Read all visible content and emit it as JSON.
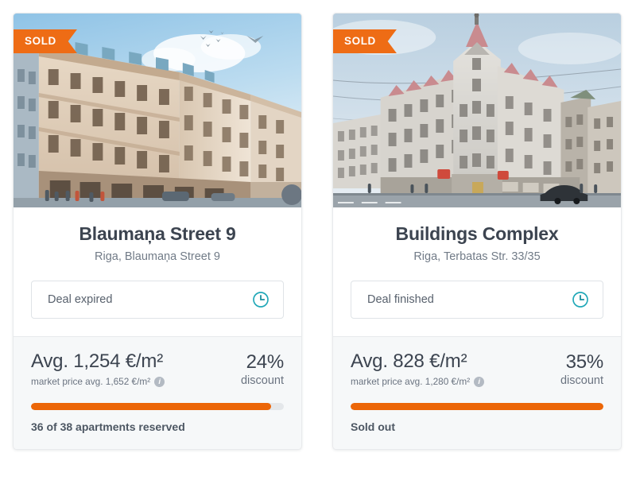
{
  "theme": {
    "accent_orange": "#ec6608",
    "badge_orange": "#ee6c15",
    "clock_teal": "#21a8b8",
    "text_dark": "#3c4450",
    "text_muted": "#6a7380",
    "footer_bg": "#f6f8f9"
  },
  "cards": [
    {
      "badge": "SOLD",
      "badge_icon": "ribbon-badge",
      "image_alt": "blaumana-street-9-building-render",
      "title": "Blaumaņa Street 9",
      "subtitle": "Riga, Blaumaņa Street 9",
      "deal_status": "Deal expired",
      "deal_status_icon": "clock-icon",
      "avg_price": "Avg. 1,254 €/m²",
      "market_price": "market price avg. 1,652 €/m²",
      "info_icon": "info-icon",
      "info_glyph": "i",
      "discount_value": "24%",
      "discount_label": "discount",
      "progress_percent": 95,
      "reserved_text": "36 of 38 apartments reserved"
    },
    {
      "badge": "SOLD",
      "badge_icon": "ribbon-badge",
      "image_alt": "terbatas-33-35-buildings-complex-photo",
      "title": "Buildings Complex",
      "subtitle": "Riga, Terbatas Str. 33/35",
      "deal_status": "Deal finished",
      "deal_status_icon": "clock-icon",
      "avg_price": "Avg. 828 €/m²",
      "market_price": "market price avg. 1,280 €/m²",
      "info_icon": "info-icon",
      "info_glyph": "i",
      "discount_value": "35%",
      "discount_label": "discount",
      "progress_percent": 100,
      "reserved_text": "Sold out"
    }
  ]
}
